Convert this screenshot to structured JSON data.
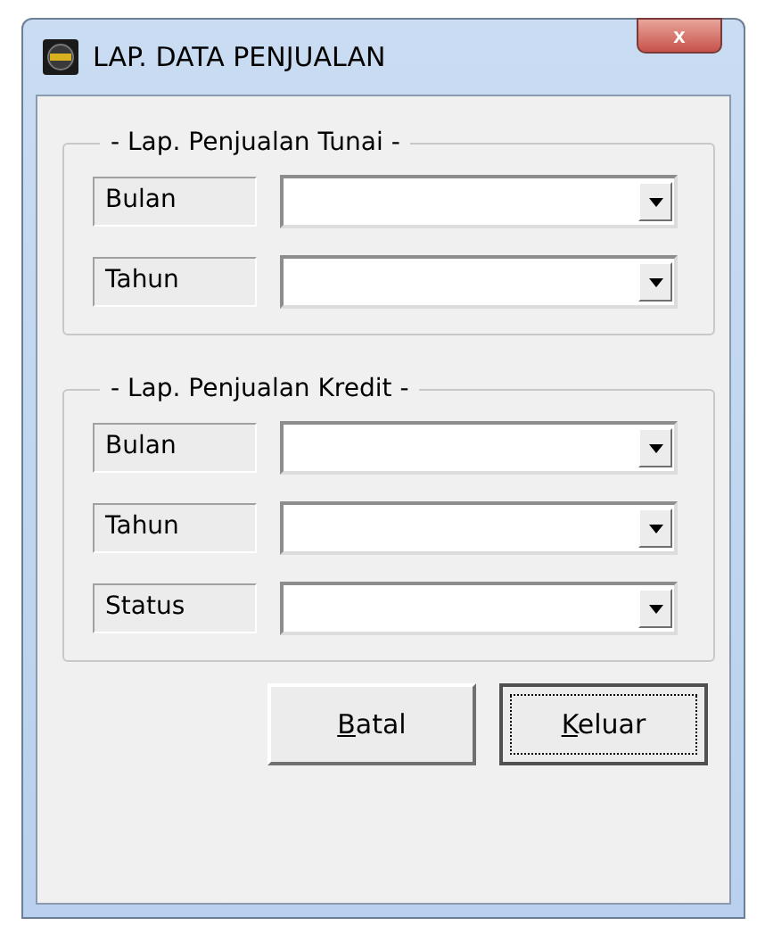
{
  "window": {
    "title": "LAP. DATA PENJUALAN",
    "close": "x"
  },
  "groups": [
    {
      "title": "- Lap. Penjualan Tunai -",
      "fields": [
        {
          "label": "Bulan"
        },
        {
          "label": "Tahun"
        }
      ]
    },
    {
      "title": "- Lap. Penjualan Kredit -",
      "fields": [
        {
          "label": "Bulan"
        },
        {
          "label": "Tahun"
        },
        {
          "label": "Status"
        }
      ]
    }
  ],
  "buttons": [
    {
      "label": "Batal",
      "focused": false
    },
    {
      "label": "Keluar",
      "focused": true
    }
  ]
}
